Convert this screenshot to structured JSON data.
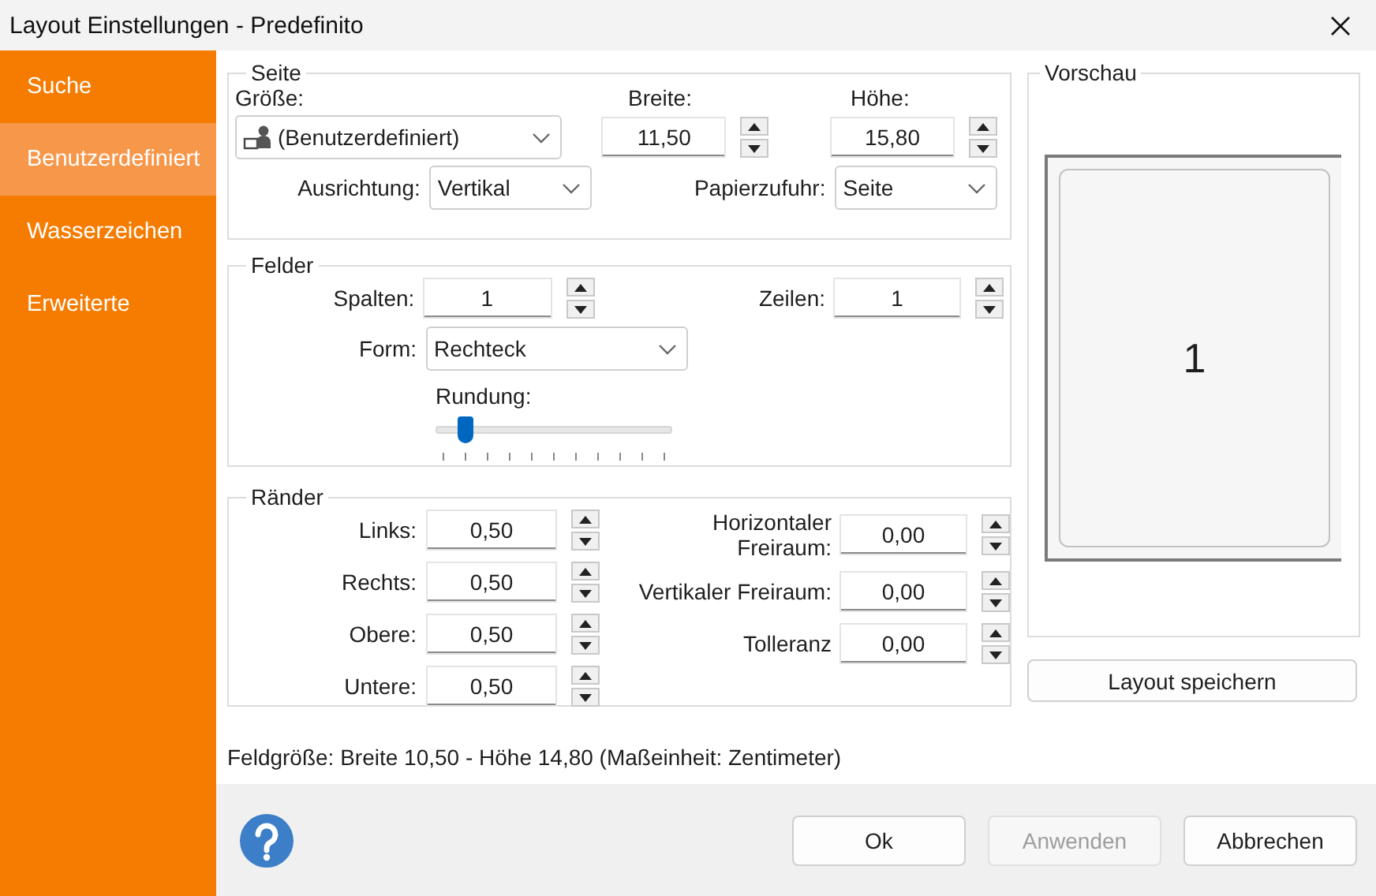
{
  "window": {
    "title": "Layout Einstellungen - Predefinito"
  },
  "sidebar": {
    "items": [
      {
        "label": "Suche",
        "selected": false
      },
      {
        "label": "Benutzerdefiniert",
        "selected": true
      },
      {
        "label": "Wasserzeichen",
        "selected": false
      },
      {
        "label": "Erweiterte",
        "selected": false
      }
    ]
  },
  "page_group": {
    "title": "Seite",
    "size": {
      "label": "Größe:",
      "value": "(Benutzerdefiniert)"
    },
    "width": {
      "label": "Breite:",
      "value": "11,50"
    },
    "height": {
      "label": "Höhe:",
      "value": "15,80"
    },
    "orientation": {
      "label": "Ausrichtung:",
      "value": "Vertikal"
    },
    "paper_feed": {
      "label": "Papierzufuhr:",
      "value": "Seite"
    }
  },
  "fields_group": {
    "title": "Felder",
    "columns": {
      "label": "Spalten:",
      "value": "1"
    },
    "rows": {
      "label": "Zeilen:",
      "value": "1"
    },
    "shape": {
      "label": "Form:",
      "value": "Rechteck"
    },
    "rounding": {
      "label": "Rundung:",
      "level": 0.1
    }
  },
  "margins_group": {
    "title": "Ränder",
    "left": [
      {
        "label": "Links:",
        "value": "0,50"
      },
      {
        "label": "Rechts:",
        "value": "0,50"
      },
      {
        "label": "Obere:",
        "value": "0,50"
      },
      {
        "label": "Untere:",
        "value": "0,50"
      }
    ],
    "right": [
      {
        "label": "Horizontaler Freiraum:",
        "value": "0,00"
      },
      {
        "label": "Vertikaler Freiraum:",
        "value": "0,00"
      },
      {
        "label": "Tolleranz",
        "value": "0,00"
      }
    ]
  },
  "preview": {
    "title": "Vorschau",
    "page_number": "1"
  },
  "save_button": "Layout speichern",
  "field_size": "Feldgröße: Breite 10,50 - Höhe 14,80 (Maßeinheit: Zentimeter)",
  "buttons": [
    {
      "label": "Ok",
      "disabled": false
    },
    {
      "label": "Anwenden",
      "disabled": true
    },
    {
      "label": "Abbrechen",
      "disabled": false
    }
  ]
}
